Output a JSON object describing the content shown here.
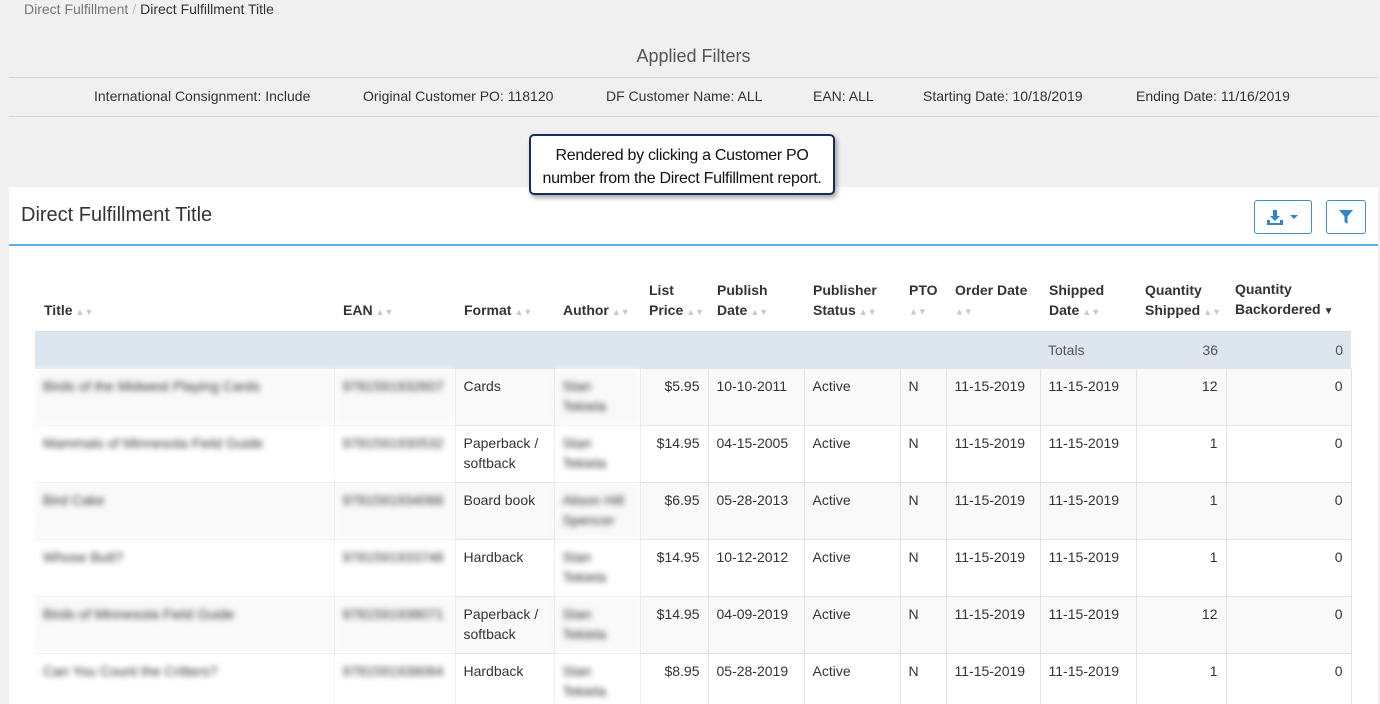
{
  "breadcrumb": {
    "parent": "Direct Fulfillment",
    "separator": "/",
    "current": "Direct Fulfillment Title"
  },
  "filters": {
    "title": "Applied Filters",
    "items": [
      "International Consignment: Include",
      "Original Customer PO: 118120",
      "DF Customer Name: ALL",
      "EAN: ALL",
      "Starting Date: 10/18/2019",
      "Ending Date: 11/16/2019"
    ]
  },
  "callout": {
    "line1": "Rendered by clicking a Customer PO",
    "line2": "number from the Direct Fulfillment report."
  },
  "panel": {
    "title": "Direct Fulfillment Title",
    "download_icon": "download-icon",
    "filter_icon": "filter-icon",
    "accent_color": "#5aaee0"
  },
  "table": {
    "headers": {
      "title": "Title",
      "ean": "EAN",
      "format": "Format",
      "author": "Author",
      "list_price": "List Price",
      "publish_date": "Publish Date",
      "publisher_status": "Publisher Status",
      "pto": "PTO",
      "order_date": "Order Date",
      "shipped_date": "Shipped Date",
      "quantity_shipped": "Quantity Shipped",
      "quantity_backordered": "Quantity Backordered"
    },
    "totals": {
      "label": "Totals",
      "shipped": "36",
      "backordered": "0"
    },
    "rows": [
      {
        "title": "Birds of the Midwest Playing Cards",
        "ean": "9781591932607",
        "format": "Cards",
        "author": "Stan Tekiela",
        "price": "$5.95",
        "publish": "10-10-2011",
        "status": "Active",
        "pto": "N",
        "order": "11-15-2019",
        "shipped": "11-15-2019",
        "qty_shipped": "12",
        "qty_back": "0"
      },
      {
        "title": "Mammals of Minnesota Field Guide",
        "ean": "9781591930532",
        "format": "Paperback / softback",
        "author": "Stan Tekiela",
        "price": "$14.95",
        "publish": "04-15-2005",
        "status": "Active",
        "pto": "N",
        "order": "11-15-2019",
        "shipped": "11-15-2019",
        "qty_shipped": "1",
        "qty_back": "0"
      },
      {
        "title": "Bird Cake",
        "ean": "9781591934066",
        "format": "Board book",
        "author": "Alison Hill Spencer",
        "price": "$6.95",
        "publish": "05-28-2013",
        "status": "Active",
        "pto": "N",
        "order": "11-15-2019",
        "shipped": "11-15-2019",
        "qty_shipped": "1",
        "qty_back": "0"
      },
      {
        "title": "Whose Butt?",
        "ean": "9781591933748",
        "format": "Hardback",
        "author": "Stan Tekiela",
        "price": "$14.95",
        "publish": "10-12-2012",
        "status": "Active",
        "pto": "N",
        "order": "11-15-2019",
        "shipped": "11-15-2019",
        "qty_shipped": "1",
        "qty_back": "0"
      },
      {
        "title": "Birds of Minnesota Field Guide",
        "ean": "9781591938071",
        "format": "Paperback / softback",
        "author": "Stan Tekiela",
        "price": "$14.95",
        "publish": "04-09-2019",
        "status": "Active",
        "pto": "N",
        "order": "11-15-2019",
        "shipped": "11-15-2019",
        "qty_shipped": "12",
        "qty_back": "0"
      },
      {
        "title": "Can You Count the Critters?",
        "ean": "9781591938064",
        "format": "Hardback",
        "author": "Stan Tekiela",
        "price": "$8.95",
        "publish": "05-28-2019",
        "status": "Active",
        "pto": "N",
        "order": "11-15-2019",
        "shipped": "11-15-2019",
        "qty_shipped": "1",
        "qty_back": "0"
      }
    ]
  }
}
